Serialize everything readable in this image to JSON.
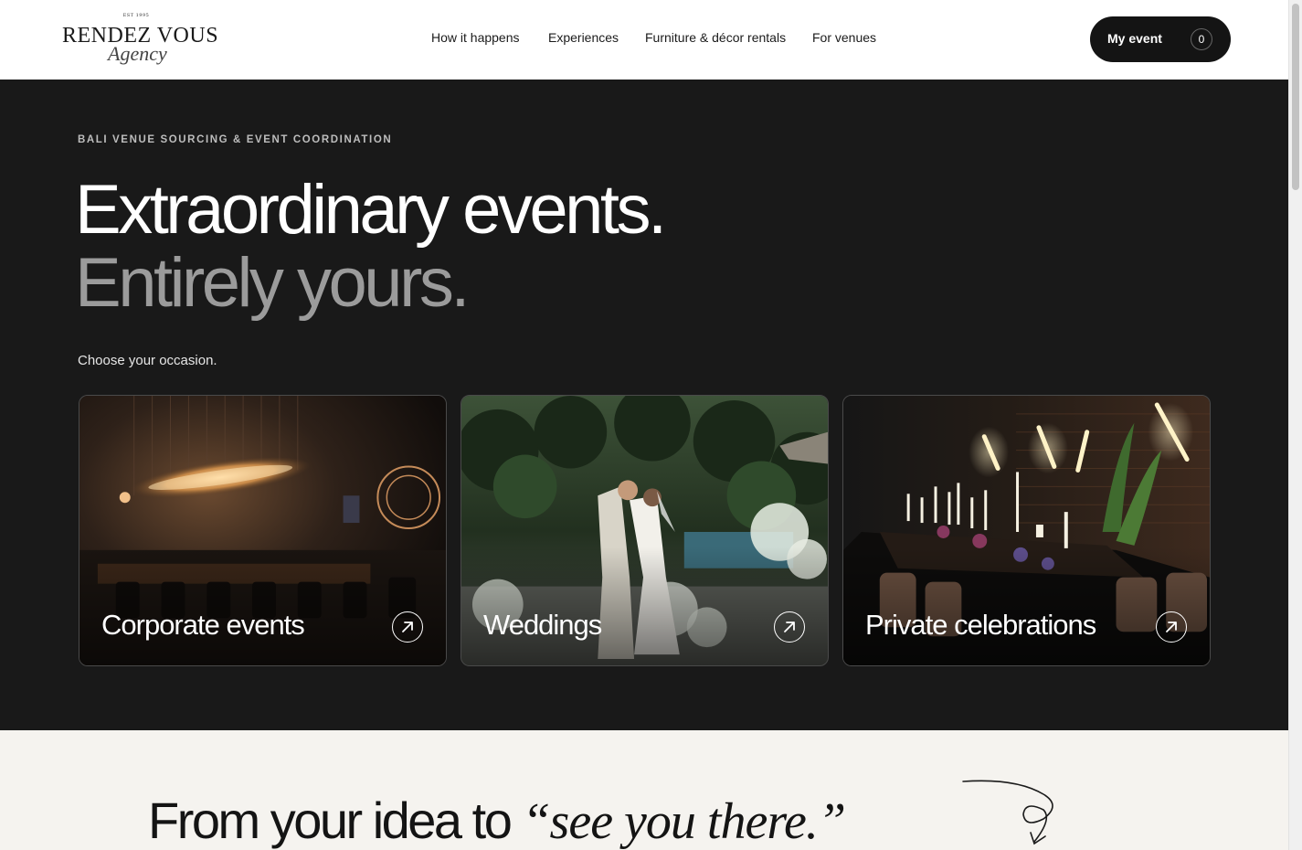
{
  "header": {
    "logo": {
      "est": "EST 1995",
      "name": "RENDEZ VOUS",
      "script": "Agency"
    },
    "nav": [
      {
        "label": "How it happens"
      },
      {
        "label": "Experiences"
      },
      {
        "label": "Furniture & décor rentals"
      },
      {
        "label": "For venues"
      }
    ],
    "my_event": {
      "label": "My event",
      "count": "0"
    }
  },
  "hero": {
    "eyebrow": "BALI VENUE SOURCING & EVENT COORDINATION",
    "headline_line1": "Extraordinary events.",
    "headline_line2": "Entirely yours.",
    "prompt": "Choose your occasion.",
    "cards": [
      {
        "title": "Corporate events",
        "icon": "arrow-up-right-icon"
      },
      {
        "title": "Weddings",
        "icon": "arrow-up-right-icon"
      },
      {
        "title": "Private celebrations",
        "icon": "arrow-up-right-icon"
      }
    ]
  },
  "lower": {
    "title_plain": "From your idea to ",
    "title_accent": "“see you there.”"
  },
  "colors": {
    "header_bg": "#ffffff",
    "hero_bg": "#191919",
    "section_bg": "#f5f3ef",
    "button_bg": "#141414",
    "headline_primary": "#ffffff",
    "headline_secondary": "#9b9b9b"
  }
}
